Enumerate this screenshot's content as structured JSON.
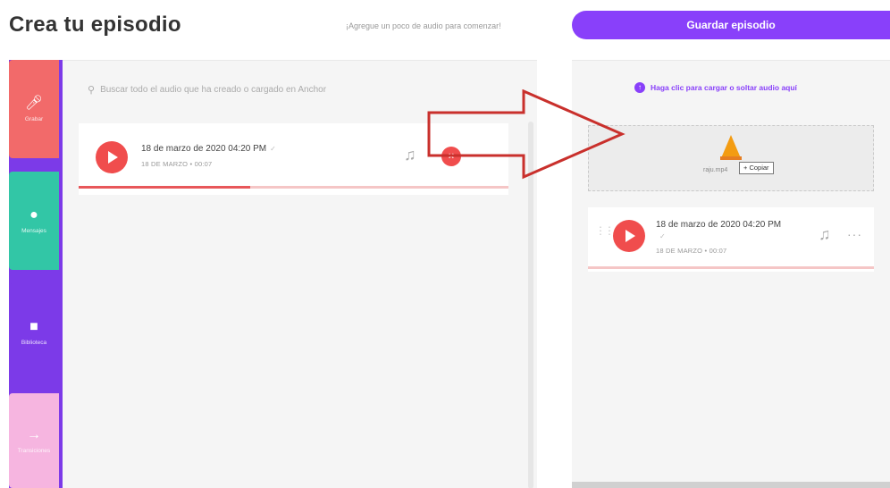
{
  "header": {
    "page_title": "Crea tu episodio",
    "hint": "¡Agregue un poco de audio para comenzar!",
    "save_label": "Guardar episodio"
  },
  "tools": {
    "record_label": "Grabar",
    "messages_label": "Mensajes",
    "library_label": "Biblioteca",
    "transitions_label": "Transiciones"
  },
  "library": {
    "search_placeholder": "Buscar todo el audio que ha creado o cargado en Anchor",
    "clip": {
      "title": "18 de marzo de 2020 04:20 PM",
      "meta": "18 DE MARZO • 00:07",
      "remove_label": "×",
      "progress_percent": 40
    }
  },
  "episode": {
    "upload_hint": "Haga clic para cargar o soltar audio aquí",
    "drop_text": "raju.mp4",
    "copy_tooltip": "+ Copiar",
    "clip": {
      "title": "18 de marzo de 2020 04:20 PM",
      "meta": "18 DE MARZO • 00:07",
      "more_label": "···"
    }
  },
  "icons": {
    "record": "microphone-icon",
    "messages": "message-icon",
    "library": "folder-icon",
    "transitions": "arrow-right-icon",
    "search": "search-icon",
    "upload": "upload-icon",
    "music": "music-note-icon"
  },
  "colors": {
    "brand_purple": "#8940fa",
    "record_red": "#f26a6a",
    "messages_green": "#32c6a6",
    "transitions_pink": "#f6b5e0",
    "play_red": "#f04d4d",
    "annotation_arrow": "#c9302c"
  }
}
